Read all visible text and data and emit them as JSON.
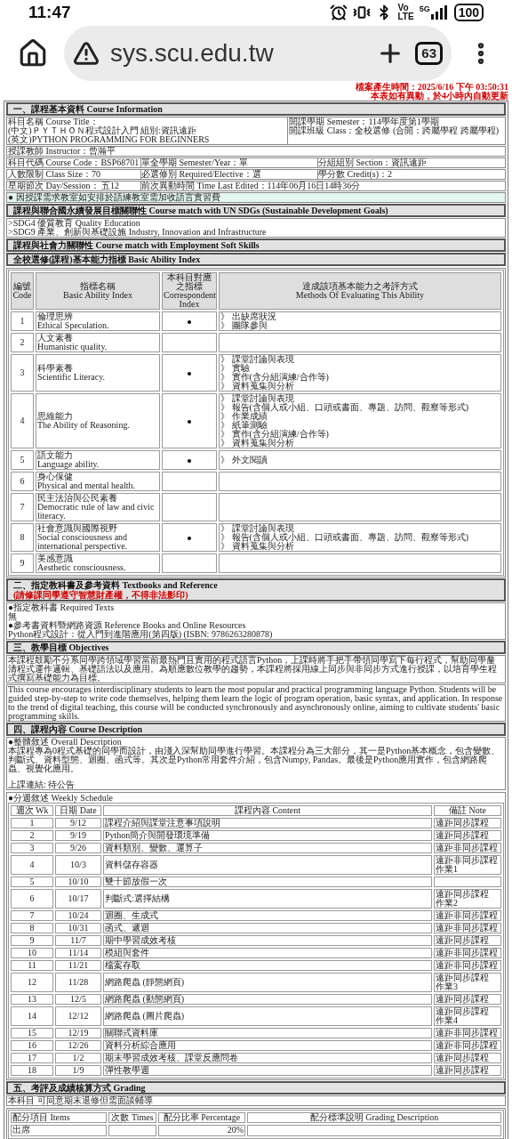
{
  "status_bar": {
    "time": "11:47",
    "volte_top": "Vo",
    "volte_bottom": "LTE",
    "network": "5G",
    "battery": "100"
  },
  "browser": {
    "url": "sys.scu.edu.tw",
    "tab_count": "63"
  },
  "generated": [
    "檔案產生時間：2025/6/16 下午 03:50:31",
    "本表如有異動，於4小時內自動更新"
  ],
  "course_info": {
    "heading": "一、課程基本資料 Course Information",
    "title_lines": [
      "科目名稱 Course Title：",
      "(中文)ＰＹＴＨＯＮ程式設計入門  組別:資訊遠距",
      "(英文)PYTHON PROGRAMMING FOR BEGINNERS"
    ],
    "semester_lines": [
      "開課學期 Semester：114學年度第1學期",
      "開課班級 Class：全校選修 (合開：跨屬學程 跨屬學程)"
    ],
    "instructor": "授課教師 Instructor：曾瀚平",
    "fields": [
      [
        "科目代碼 Course Code：BSP68701",
        "單全學期 Semester/Year：單",
        "分組組別 Section：資訊遠距"
      ],
      [
        "人數限制 Class Size：70",
        "必選修別 Required/Elective：選",
        "學分數 Credit(s)：2"
      ],
      [
        "星期節次 Day/Session： 五12",
        "前次異動時間 Time Last Edited：114年06月16日14時36分"
      ]
    ],
    "notice": "● 因授課需求教室如安排於語練教室需加收語言實習費"
  },
  "sdg": {
    "heading": "課程與聯合國永續發展目標關聯性 Course match with UN SDGs (Sustainable Development Goals)",
    "items": [
      ">SDG4 優質教育 Quality Education",
      ">SDG9 產業、創新與基礎設施 Industry, Innovation and Infrastructure"
    ]
  },
  "soft_skills": {
    "heading": "課程與社會力關聯性 Course match with Employment Soft Skills"
  },
  "ability": {
    "heading": "全校選修(課程)基本能力指標 Basic Ability Index",
    "columns": [
      {
        "zh": "編號",
        "en": "Code"
      },
      {
        "zh": "指標名稱",
        "en": "Basic Ability Index"
      },
      {
        "zh": "本科目對應之指標",
        "en": "Correspondent Index"
      },
      {
        "zh": "達成該項基本能力之考評方式",
        "en": "Methods Of Evaluating This Ability"
      }
    ],
    "rows": [
      {
        "code": "1",
        "zh": "倫理思辨",
        "en": "Ethical Speculation.",
        "selected": true,
        "methods": [
          "》 出缺席狀況",
          "》 團隊參與"
        ]
      },
      {
        "code": "2",
        "zh": "人文素養",
        "en": "Humanistic quality.",
        "selected": false
      },
      {
        "code": "3",
        "zh": "科學素養",
        "en": "Scientific Literacy.",
        "selected": true,
        "methods": [
          "》 課堂討論與表現",
          "》 實驗",
          "》 實作(含分組演練/合作等)",
          "》 資料蒐集與分析"
        ]
      },
      {
        "code": "4",
        "zh": "思維能力",
        "en": "The Ability of Reasoning.",
        "selected": true,
        "methods": [
          "》 課堂討論與表現",
          "》 報告(含個人或小組、口頭或書面、專題、訪問、觀察等形式)",
          "》 作業成績",
          "》 紙筆測驗",
          "》 實作(含分組演練/合作等)",
          "》 資料蒐集與分析"
        ]
      },
      {
        "code": "5",
        "zh": "語文能力",
        "en": "Language ability.",
        "selected": true,
        "methods": [
          "》 外文閱讀"
        ]
      },
      {
        "code": "6",
        "zh": "身心保健",
        "en": "Physical and mental health.",
        "selected": false
      },
      {
        "code": "7",
        "zh": "民主法治與公民素養",
        "en": "Democratic rule of law and civic literacy.",
        "selected": false
      },
      {
        "code": "8",
        "zh": "社會意識與國際視野",
        "en": "Social consciousness and international perspective.",
        "selected": true,
        "methods": [
          "》 課堂討論與表現",
          "》 報告(含個人或小組、口頭或書面、專題、訪問、觀察等形式)",
          "》 資料蒐集與分析"
        ]
      },
      {
        "code": "9",
        "zh": "美感意識",
        "en": "Aesthetic consciousness.",
        "selected": false
      }
    ]
  },
  "textbooks": {
    "heading": "二、指定教科書及參考資料 Textbooks and Reference",
    "warning": "(請修課同學遵守智慧財產權，不得非法影印)",
    "lines": [
      "●指定教科書 Required Texts",
      "無",
      "●參考書資料暨網路資源 Reference Books and Online Resources",
      "Python程式設計：從入門到進階應用(第四版) (ISBN: 9786263280878)"
    ]
  },
  "objectives": {
    "heading": "三、教學目標 Objectives",
    "zh": "本課程鼓勵不分系同學跨領域學習當前最熱門且實用的程式語言Python，上課時將手把手帶領同學寫下每行程式，幫助同學釐清程式運作邏輯、基礎語法以及應用。為順應數位教學的趨勢，本課程將採用線上同步與非同步方式進行授課，以培育學生程式撰寫基礎能力為目標。",
    "en": "This course encourages interdisciplinary students to learn the most popular and practical programming language Python. Students will be guided step-by-step to write code themselves, helping them learn the logic of program operation, basic syntax, and application. In response to the trend of digital teaching, this course will be conducted synchronously and asynchronously online, aiming to cultivate students' basic programming skills."
  },
  "description": {
    "heading": "四、課程內容 Course Description",
    "overall_label": "●整體敘述 Overall Description",
    "overall": "本課程專為0程式基礎的同學而設計，由淺入深幫助同學進行學習。本課程分為三大部分，其一是Python基本概念，包含變數、判斷式、資料型態、迴圈、函式等。其次是Python常用套件介紹，包含Numpy, Pandas。最後是Python應用實作，包含網路爬蟲、視覺化應用。",
    "link": "上課連結: 待公告",
    "weekly_label": "●分週敘述 Weekly Schedule",
    "columns": [
      "週次 Wk",
      "日期 Date",
      "課程內容 Content",
      "備註 Note"
    ],
    "rows": [
      {
        "wk": "1",
        "date": "9/12",
        "content": "課程介紹與課堂注意事項說明",
        "note": [
          "遠距同步課程"
        ]
      },
      {
        "wk": "2",
        "date": "9/19",
        "content": "Python簡介與開發環境準備",
        "note": [
          "遠距同步課程"
        ]
      },
      {
        "wk": "3",
        "date": "9/26",
        "content": "資料類別、變數、運算子",
        "note": [
          "遠距非同步課程"
        ]
      },
      {
        "wk": "4",
        "date": "10/3",
        "content": "資料儲存容器",
        "note": [
          "遠距非同步課程",
          "作業1"
        ]
      },
      {
        "wk": "5",
        "date": "10/10",
        "content": "雙十節放假一次"
      },
      {
        "wk": "6",
        "date": "10/17",
        "content": "判斷式:選擇結構",
        "note": [
          "遠距同步課程",
          "作業2"
        ]
      },
      {
        "wk": "7",
        "date": "10/24",
        "content": "迴圈、生成式",
        "note": [
          "遠距非同步課程"
        ]
      },
      {
        "wk": "8",
        "date": "10/31",
        "content": "函式、遞迴",
        "note": [
          "遠距非同步課程"
        ]
      },
      {
        "wk": "9",
        "date": "11/7",
        "content": "期中學習成效考核",
        "note": [
          "遠距同步課程"
        ]
      },
      {
        "wk": "10",
        "date": "11/14",
        "content": "模組與套件",
        "note": [
          "遠距非同步課程"
        ]
      },
      {
        "wk": "11",
        "date": "11/21",
        "content": "檔案存取",
        "note": [
          "遠距非同步課程"
        ]
      },
      {
        "wk": "12",
        "date": "11/28",
        "content": "網路爬蟲 (靜態網頁)",
        "note": [
          "遠距同步課程",
          "作業3"
        ]
      },
      {
        "wk": "13",
        "date": "12/5",
        "content": "網路爬蟲 (動態網頁)",
        "note": [
          "遠距同步課程"
        ]
      },
      {
        "wk": "14",
        "date": "12/12",
        "content": "網路爬蟲 (圖片爬蟲)",
        "note": [
          "遠距同步課程",
          "作業4"
        ]
      },
      {
        "wk": "15",
        "date": "12/19",
        "content": "關聯式資料庫",
        "note": [
          "遠距非同步課程"
        ]
      },
      {
        "wk": "16",
        "date": "12/26",
        "content": "資料分析綜合應用",
        "note": [
          "遠距非同步課程"
        ]
      },
      {
        "wk": "17",
        "date": "1/2",
        "content": "期末學習成效考核、課堂反應問卷",
        "note": [
          "遠距同步課程"
        ]
      },
      {
        "wk": "18",
        "date": "1/9",
        "content": "彈性教學週",
        "note": [
          "遠距同步課程"
        ]
      }
    ]
  },
  "grading": {
    "heading": "五、考評及成績核算方式 Grading",
    "note": "本科目 可同意期末退修但需面談輔導",
    "columns": [
      "配分項目 Items",
      "次數 Times",
      "配分比率 Percentage",
      "配分標準說明 Grading Description"
    ],
    "rows": [
      {
        "item": "出席",
        "percentage": "20%"
      }
    ]
  }
}
